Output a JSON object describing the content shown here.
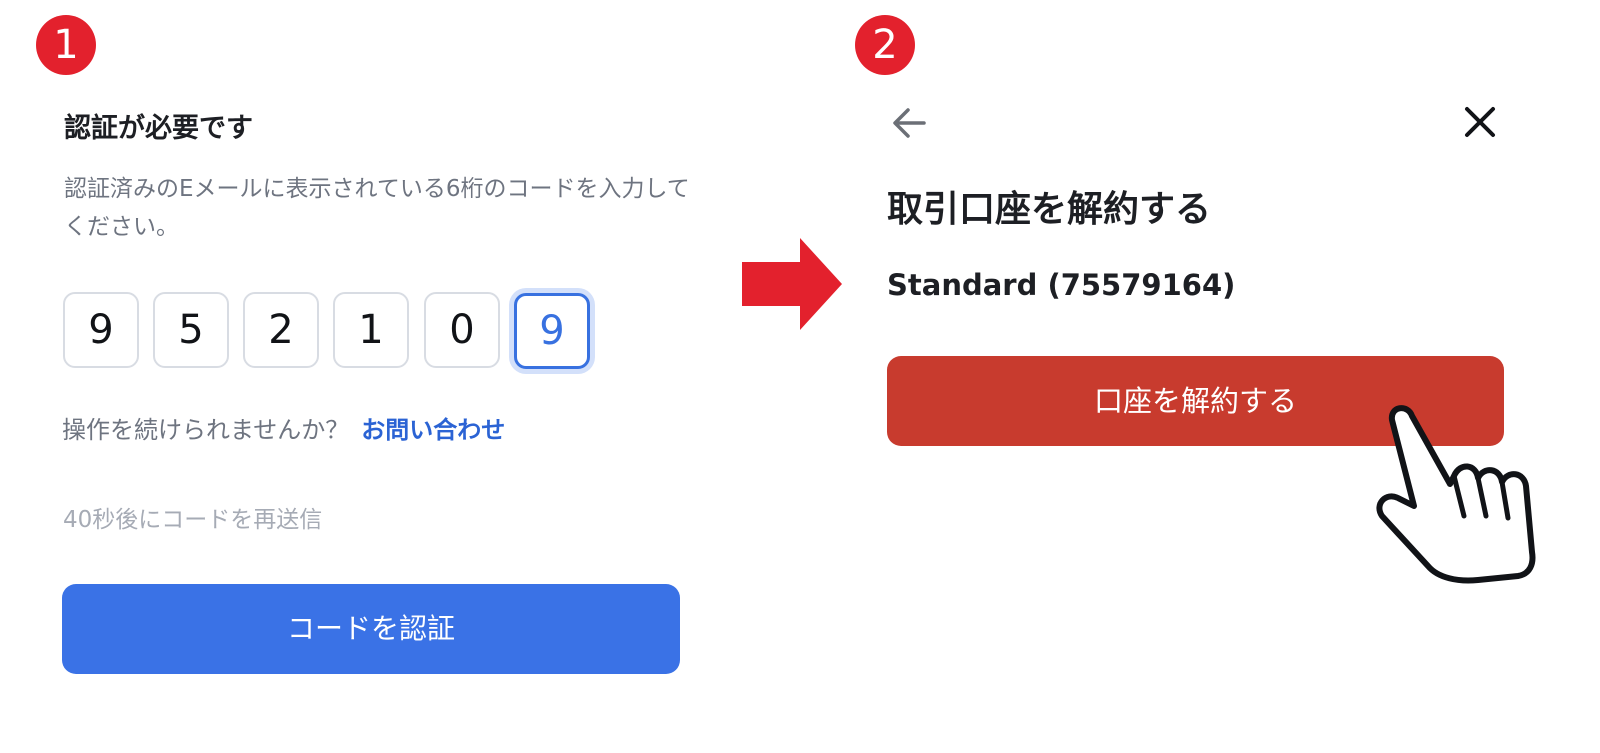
{
  "steps": {
    "one": "1",
    "two": "2"
  },
  "panel1": {
    "title": "認証が必要です",
    "description": "認証済みのEメールに表示されている6桁のコードを入力してください。",
    "otp_digits": [
      "9",
      "5",
      "2",
      "1",
      "0",
      "9"
    ],
    "help_text": "操作を続けられませんか？",
    "help_link": "お問い合わせ",
    "resend_text": "40秒後にコードを再送信",
    "verify_button": "コードを認証"
  },
  "panel2": {
    "title": "取引口座を解約する",
    "account": "Standard (75579164)",
    "close_account_button": "口座を解約する"
  },
  "colors": {
    "badge": "#e3212d",
    "verify_button": "#3a72e6",
    "close_account_button": "#c83b2e",
    "link": "#2b63d4",
    "arrow": "#e3212d"
  },
  "icons": {
    "back": "arrow-left-icon",
    "close": "close-icon",
    "pointer": "pointing-hand-icon",
    "flow": "right-arrow-icon"
  }
}
